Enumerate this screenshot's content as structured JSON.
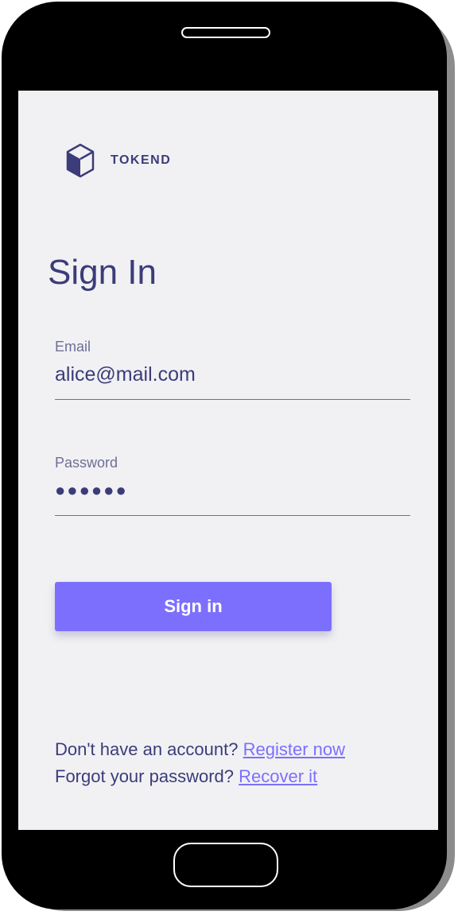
{
  "brand": {
    "name": "TOKEND",
    "logo_icon": "hexagon-cube-icon"
  },
  "page": {
    "title": "Sign In"
  },
  "form": {
    "email": {
      "label": "Email",
      "value": "alice@mail.com"
    },
    "password": {
      "label": "Password",
      "value": "●●●●●●"
    },
    "submit_label": "Sign in"
  },
  "footer": {
    "register_prompt": "Don't have an account?",
    "register_link": "Register now",
    "recover_prompt": "Forgot your password?",
    "recover_link": "Recover it"
  },
  "colors": {
    "primary_text": "#3b3c79",
    "muted_text": "#6e6f96",
    "accent": "#7d6ffd",
    "screen_background": "#f1f1f4",
    "device_frame": "#000000"
  }
}
